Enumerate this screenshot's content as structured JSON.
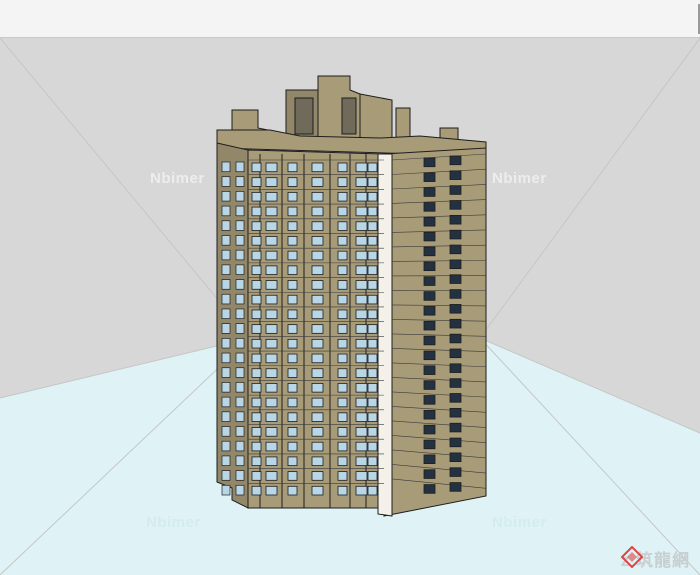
{
  "viewport": {
    "model": "high-rise residential tower",
    "sky_color": "#d7d7d7",
    "ground_color": "#dff3f6",
    "facade_color": "#a89b78",
    "facade_shadow_color": "#93876a",
    "window_color": "#b8d6e6",
    "edge_color": "#1e1e1e"
  },
  "watermarks": [
    "Nbimer",
    "Nbimer",
    "Nbimer",
    "Nbimer"
  ],
  "logo": {
    "icon": "diamond-logo-icon",
    "text": "z 筑龍網"
  }
}
